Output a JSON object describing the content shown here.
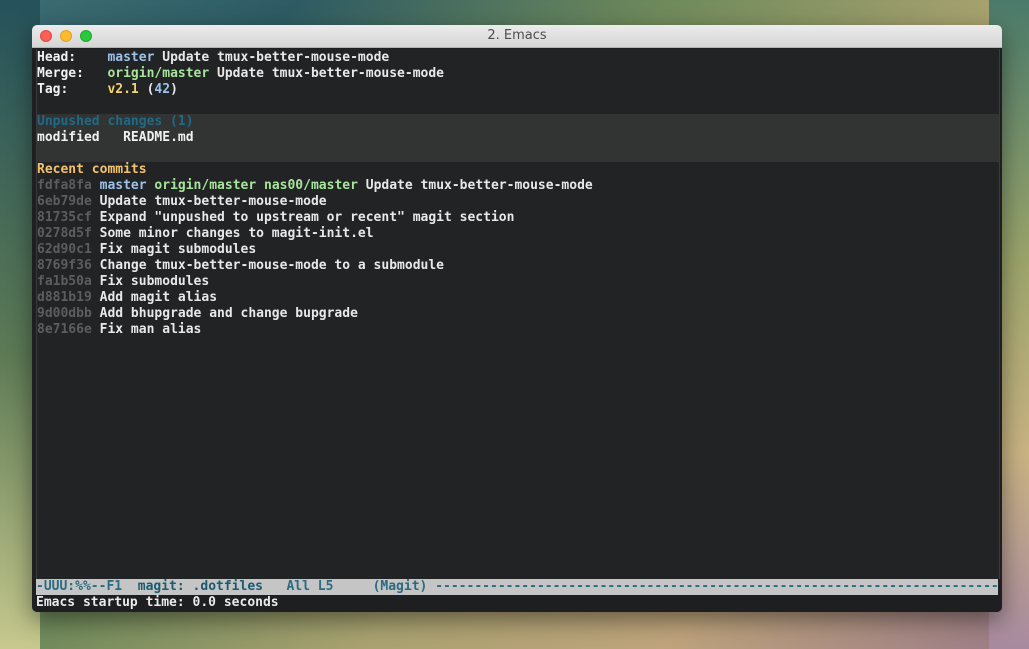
{
  "window": {
    "title": "2. Emacs"
  },
  "header": {
    "head_label": "Head:",
    "head_branch": "master",
    "head_msg": "Update tmux-better-mouse-mode",
    "merge_label": "Merge:",
    "merge_branch": "origin/master",
    "merge_msg": "Update tmux-better-mouse-mode",
    "tag_label": "Tag:",
    "tag_name": "v2.1",
    "tag_count_open": "(",
    "tag_count": "42",
    "tag_count_close": ")"
  },
  "unpushed": {
    "heading": "Unpushed changes (1)",
    "status": "modified",
    "file": "README.md"
  },
  "recent": {
    "heading": "Recent commits",
    "commits": [
      {
        "hash": "fdfa8fa",
        "refs": [
          "master",
          "origin/master",
          "nas00/master"
        ],
        "msg": "Update tmux-better-mouse-mode"
      },
      {
        "hash": "6eb79de",
        "refs": [],
        "msg": "Update tmux-better-mouse-mode"
      },
      {
        "hash": "81735cf",
        "refs": [],
        "msg": "Expand \"unpushed to upstream or recent\" magit section"
      },
      {
        "hash": "0278d5f",
        "refs": [],
        "msg": "Some minor changes to magit-init.el"
      },
      {
        "hash": "62d90c1",
        "refs": [],
        "msg": "Fix magit submodules"
      },
      {
        "hash": "8769f36",
        "refs": [],
        "msg": "Change tmux-better-mouse-mode to a submodule"
      },
      {
        "hash": "fa1b50a",
        "refs": [],
        "msg": "Fix submodules"
      },
      {
        "hash": "d881b19",
        "refs": [],
        "msg": "Add magit alias"
      },
      {
        "hash": "9d00dbb",
        "refs": [],
        "msg": "Add bhupgrade and change bupgrade"
      },
      {
        "hash": "8e7166e",
        "refs": [],
        "msg": "Fix man alias"
      }
    ]
  },
  "modeline": {
    "status": "-UUU:%%--F1",
    "buffer": "magit: .dotfiles",
    "position": "All L5",
    "mode": "(Magit)",
    "fill": "------------------------------------------------------------------------------------"
  },
  "minibuffer": {
    "message": "Emacs startup time: 0.0 seconds"
  },
  "colors": {
    "local_branch": "#9dc2ea",
    "remote_branch": "#a6e59a",
    "tag": "#f5d36d",
    "section_heading": "#f3c16d",
    "hash": "#5a5e61"
  }
}
